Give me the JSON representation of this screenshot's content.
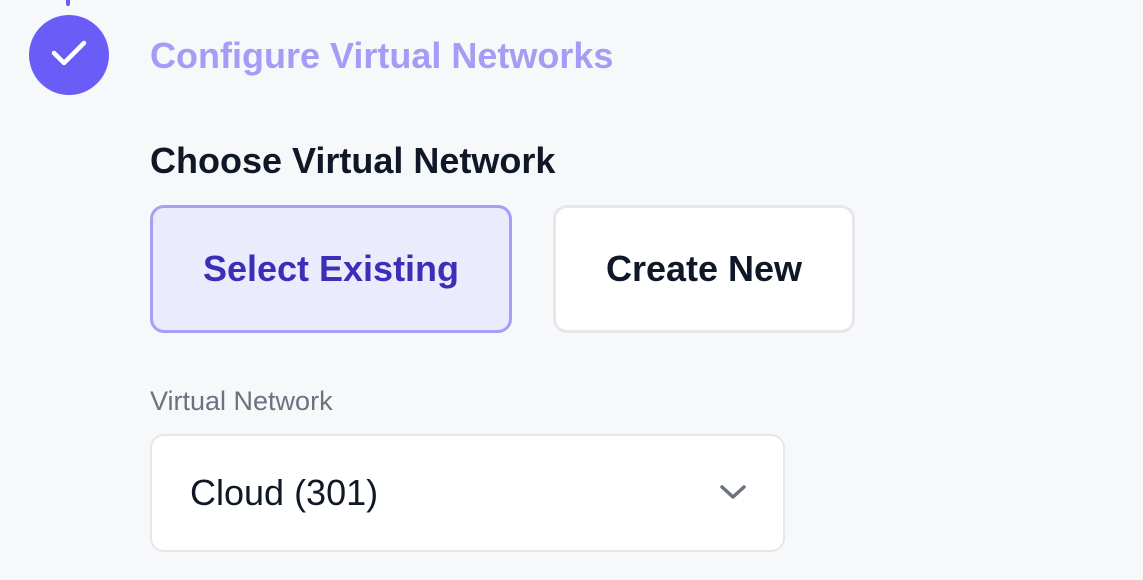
{
  "step": {
    "title": "Configure Virtual Networks",
    "status": "completed",
    "status_icon": "check-icon",
    "accent_color": "#6a5cf6"
  },
  "section": {
    "title": "Choose Virtual Network"
  },
  "choices": {
    "select_existing": {
      "label": "Select Existing",
      "selected": true
    },
    "create_new": {
      "label": "Create New",
      "selected": false
    }
  },
  "virtual_network": {
    "label": "Virtual Network",
    "value": "Cloud (301)",
    "icon": "chevron-down-icon"
  }
}
